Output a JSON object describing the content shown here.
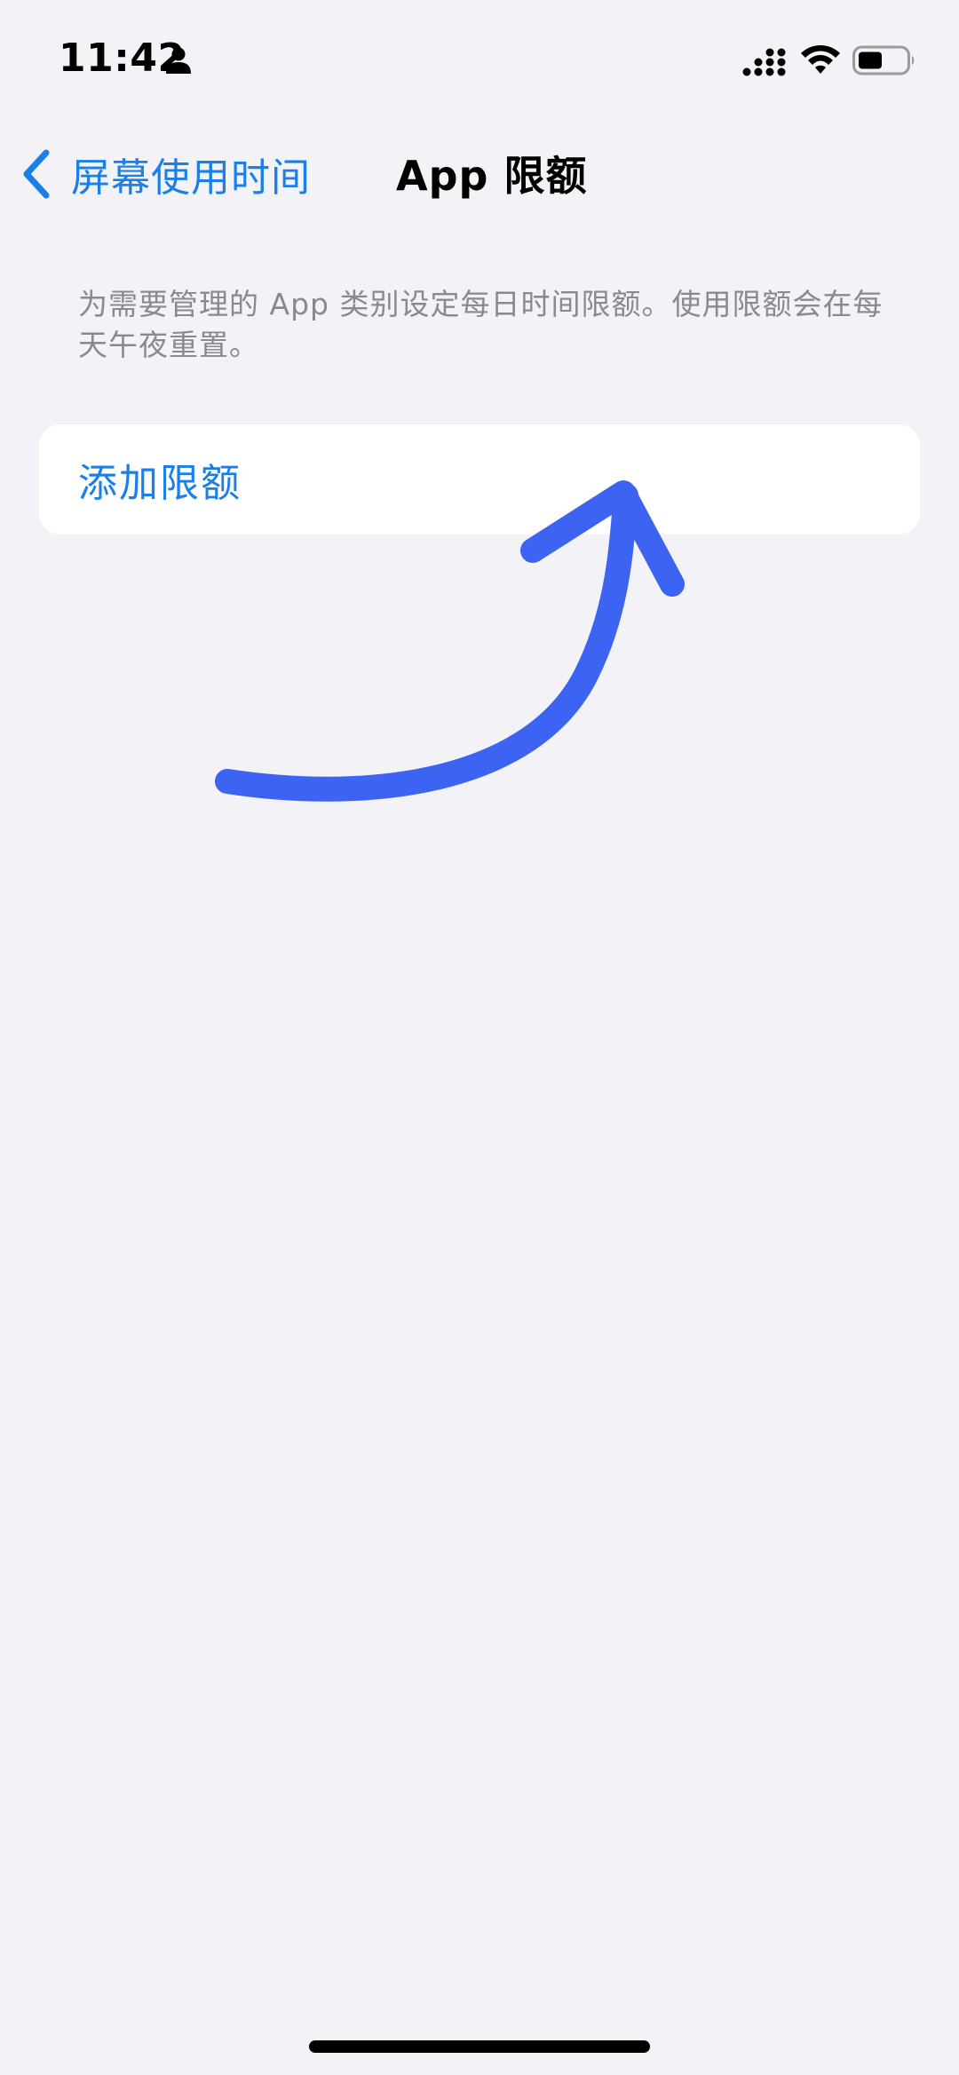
{
  "status_bar": {
    "time": "11:42",
    "icons": [
      "person-icon",
      "cellular-signal-icon",
      "wifi-icon",
      "battery-icon"
    ]
  },
  "nav": {
    "back_label": "屏幕使用时间",
    "title": "App 限额"
  },
  "description": "为需要管理的 App 类别设定每日时间限额。使用限额会在每天午夜重置。",
  "card": {
    "add_limit_label": "添加限额"
  },
  "colors": {
    "accent": "#1a7fe8",
    "background": "#f2f2f7",
    "annotation": "#3d63f2",
    "secondary_text": "#8a8a8e"
  }
}
